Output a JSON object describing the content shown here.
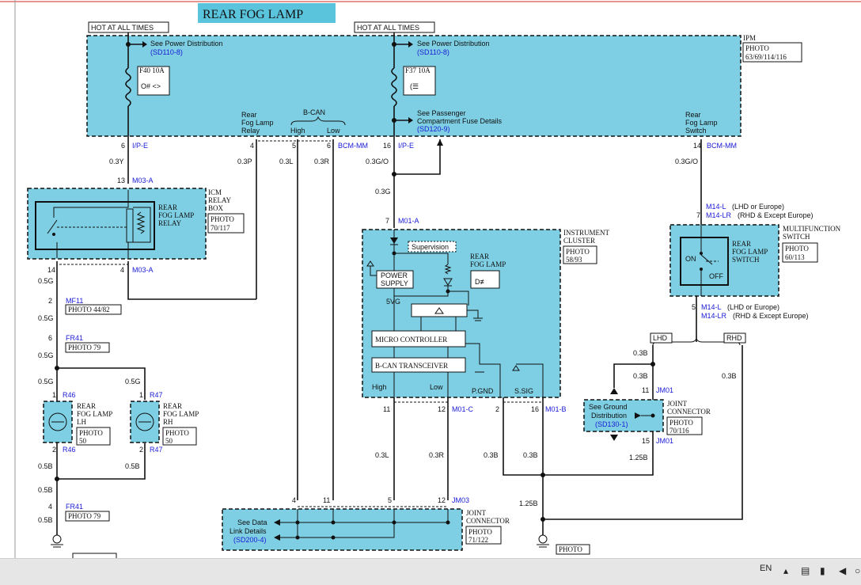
{
  "diagram": {
    "title": "REAR FOG LAMP",
    "hot1": "HOT AT ALL TIMES",
    "hot2": "HOT AT ALL TIMES",
    "ipm": {
      "name": "IPM",
      "photo": "PHOTO",
      "photo_ref": "63/69/114/116"
    },
    "pd1": {
      "text": "See Power Distribution",
      "ref": "(SD110-8)"
    },
    "pd2": {
      "text": "See Power Distribution",
      "ref": "(SD110-8)"
    },
    "fuse1": "F40 10A",
    "fuse2": "F37 10A",
    "pass": {
      "l1": "See Passenger",
      "l2": "Compartment Fuse Details",
      "ref": "(SD120-9)"
    },
    "relay_lbl": [
      "Rear",
      "Fog Lamp",
      "Relay"
    ],
    "bcan": {
      "label": "B-CAN",
      "high": "High",
      "low": "Low"
    },
    "rfl_switch_lbl": [
      "Rear",
      "Fog Lamp",
      "Switch"
    ],
    "pins": {
      "p6": "6",
      "ipe1": "I/P-E",
      "p4": "4",
      "p5": "5",
      "p6b": "6",
      "bcmmm1": "BCM-MM",
      "p16": "16",
      "ipe2": "I/P-E",
      "p14": "14",
      "bcmmm2": "BCM-MM"
    },
    "wires": {
      "w03y": "0.3Y",
      "w03p": "0.3P",
      "w03l": "0.3L",
      "w03r": "0.3R",
      "w03go": "0.3G/O",
      "w03g": "0.3G",
      "w03go2": "0.3G/O"
    },
    "icm": {
      "pin13": "13",
      "c13": "M03-A",
      "name": [
        "ICM",
        "RELAY",
        "BOX"
      ],
      "photo": "PHOTO",
      "photo_ref": "70/117",
      "relay": [
        "REAR",
        "FOG LAMP",
        "RELAY"
      ],
      "pin14": "14",
      "pin4": "4",
      "c4": "M03-A"
    },
    "mf": {
      "pin": "2",
      "conn": "MF11",
      "photo": "PHOTO 44/82"
    },
    "fr": {
      "pin": "6",
      "conn": "FR41",
      "photo": "PHOTO 79"
    },
    "lower_wires": {
      "a": "0.5G",
      "b": "0.5G",
      "c": "0.5G",
      "d": "0.5G",
      "e": "0.5G"
    },
    "lamp_lh": {
      "pin1": "1",
      "c1": "R46",
      "name": [
        "REAR",
        "FOG LAMP",
        "LH"
      ],
      "photo": "PHOTO",
      "photo_ref": "50",
      "pin2": "2",
      "c2": "R46"
    },
    "lamp_rh": {
      "pin1": "1",
      "c1": "R47",
      "name": [
        "REAR",
        "FOG LAMP",
        "RH"
      ],
      "photo": "PHOTO",
      "photo_ref": "50",
      "pin2": "2",
      "c2": "R47"
    },
    "ground_wires": {
      "a": "0.5B",
      "b": "0.5B",
      "c": "0.5B",
      "d": "0.5B"
    },
    "fr2": {
      "pin": "4",
      "conn": "FR41",
      "photo": "PHOTO 79"
    },
    "cluster": {
      "pin7": "7",
      "c7": "M01-A",
      "name": [
        "INSTRUMENT",
        "CLUSTER"
      ],
      "photo": "PHOTO",
      "photo_ref": "58/93",
      "supervision": "Supervision",
      "lamp": [
        "REAR",
        "FOG LAMP"
      ],
      "power": [
        "POWER",
        "SUPPLY"
      ],
      "v5": "5VG",
      "mc": "MICRO CONTROLLER",
      "bcan": "B-CAN TRANSCEIVER",
      "high": "High",
      "low": "Low",
      "pgnd": "P.GND",
      "ssig": "S.SIG",
      "pin11": "11",
      "pin12": "12",
      "c12": "M01-C",
      "pin2": "2",
      "pin16": "16",
      "c16": "M01-B"
    },
    "cluster_wires": {
      "a": "0.3L",
      "b": "0.3R",
      "c": "0.3B",
      "d": "0.3B",
      "e": "1.25B"
    },
    "mfs": {
      "pin7": "7",
      "c7a": "M14-L",
      "c7a_note": "(LHD or Europe)",
      "c7b": "M14-LR",
      "c7b_note": "(RHD & Except Europe)",
      "name": [
        "MULTIFUNCTION",
        "SWITCH"
      ],
      "photo": "PHOTO",
      "photo_ref": "60/113",
      "sw": [
        "REAR",
        "FOG LAMP",
        "SWITCH"
      ],
      "on": "ON",
      "off": "OFF",
      "pin5": "5",
      "c5a": "M14-L",
      "c5a_note": "(LHD or Europe)",
      "c5b": "M14-LR",
      "c5b_note": "(RHD & Except Europe)"
    },
    "lhd": "LHD",
    "rhd": "RHD",
    "rhs_wires": {
      "a": "0.3B",
      "b": "0.3B",
      "c": "0.3B",
      "d": "0.3B",
      "e": "1.25B"
    },
    "jm01": {
      "pin11": "11",
      "c11": "JM01",
      "name": [
        "JOINT",
        "CONNECTOR"
      ],
      "photo": "PHOTO",
      "photo_ref": "70/116",
      "gd": [
        "See Ground",
        "Distribution"
      ],
      "gd_ref": "(SD130-1)",
      "pin15": "15",
      "c15": "JM01"
    },
    "jm03": {
      "pin4": "4",
      "pin11": "11",
      "pin5": "5",
      "pin12": "12",
      "c12": "JM03",
      "name": [
        "JOINT",
        "CONNECTOR"
      ],
      "photo": "PHOTO",
      "photo_ref": "71/122",
      "dl": [
        "See Data",
        "Link Details"
      ],
      "dl_ref": "(SD200-4)"
    },
    "bottom_photo": "PHOTO",
    "bottom_wire": "1.25B"
  },
  "taskbar": {
    "lang": "EN"
  }
}
